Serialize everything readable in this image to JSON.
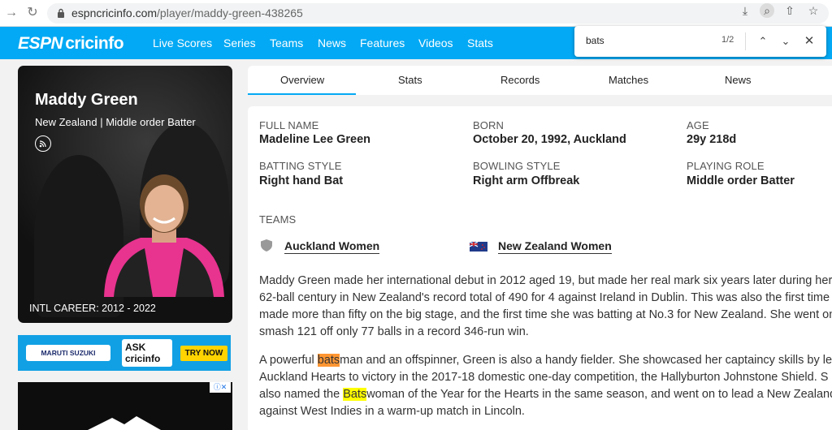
{
  "browser": {
    "url_domain": "espncricinfo.com",
    "url_path": "/player/maddy-green-438265"
  },
  "find": {
    "query": "bats",
    "count": "1/2"
  },
  "site": {
    "logo_espn": "ESPN",
    "logo_cric": "cricinfo",
    "brand_color": "#03a9f4",
    "nav": [
      "Live Scores",
      "Series",
      "Teams",
      "News",
      "Features",
      "Videos",
      "Stats"
    ]
  },
  "player": {
    "name": "Maddy Green",
    "subtitle": "New Zealand | Middle order Batter",
    "career": "INTL CAREER: 2012 - 2022"
  },
  "ad": {
    "maruti": "MARUTI SUZUKI",
    "ask_line1": "ASK",
    "ask_line2": "cricinfo",
    "cta": "TRY NOW"
  },
  "tabs": [
    "Overview",
    "Stats",
    "Records",
    "Matches",
    "News"
  ],
  "info": {
    "full_name_label": "FULL NAME",
    "full_name": "Madeline Lee Green",
    "born_label": "BORN",
    "born": "October 20, 1992, Auckland",
    "age_label": "AGE",
    "age": "29y 218d",
    "batting_label": "BATTING STYLE",
    "batting": "Right hand Bat",
    "bowling_label": "BOWLING STYLE",
    "bowling": "Right arm Offbreak",
    "role_label": "PLAYING ROLE",
    "role": "Middle order Batter",
    "teams_label": "TEAMS",
    "team1": "Auckland Women",
    "team2": "New Zealand Women"
  },
  "bio": {
    "p1_l1": "Maddy Green made her international debut in 2012 aged 19, but made her real mark six years later during her",
    "p1_l2": "62-ball century in New Zealand's record total of 490 for 4 against Ireland in Dublin. This was also the first time",
    "p1_l3": "made more than fifty on the big stage, and the first time she was batting at No.3 for New Zealand. She went on",
    "p1_l4": "smash 121 off only 77 balls in a record 346-run win.",
    "p2_l1_a": "A powerful ",
    "p2_l1_hl": "bats",
    "p2_l1_b": "man and an offspinner, Green is also a handy fielder. She showcased her captaincy skills by le",
    "p2_l2": "Auckland Hearts to victory in the 2017-18 domestic one-day competition, the Hallyburton Johnstone Shield. S",
    "p2_l3_a": "also named the ",
    "p2_l3_hl": "Bats",
    "p2_l3_b": "woman of the Year for the Hearts in the same season, and went on to lead a New Zealand",
    "p2_l4": "against West Indies in a warm-up match in Lincoln."
  }
}
